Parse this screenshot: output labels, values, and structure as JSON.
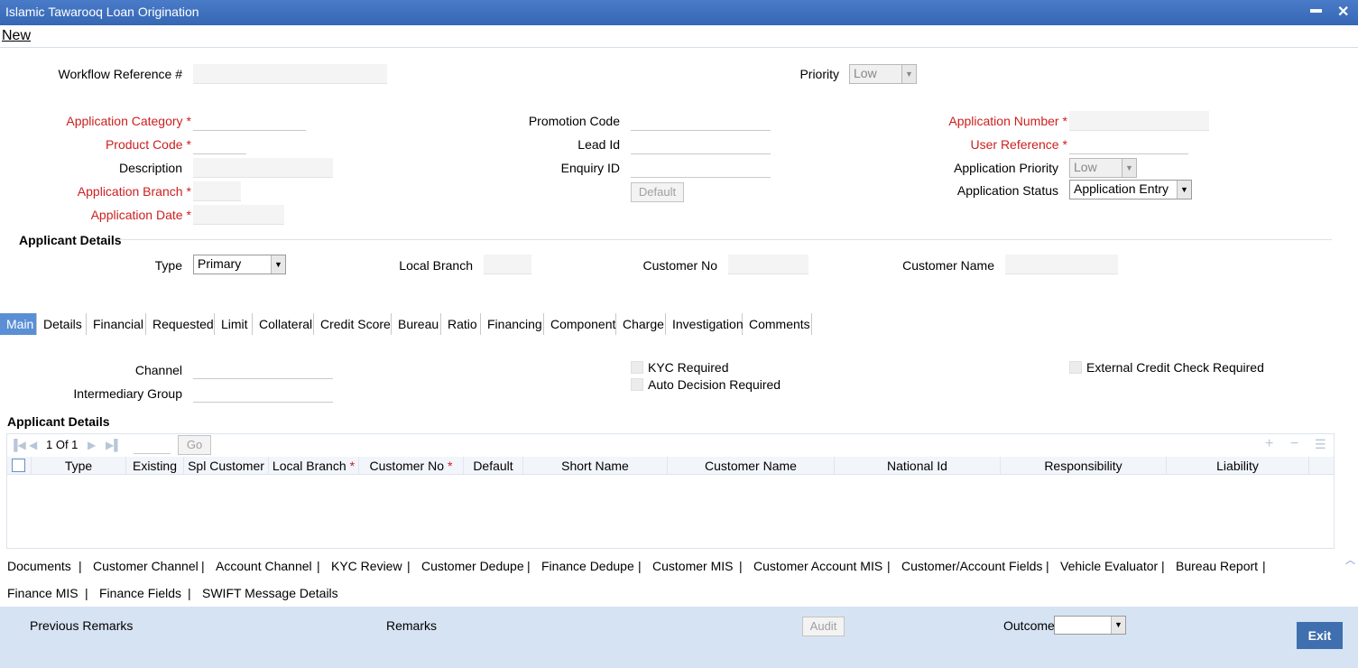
{
  "window": {
    "title": "Islamic Tawarooq Loan Origination",
    "minimize": "▬",
    "close": "✕"
  },
  "menu": {
    "new": "New"
  },
  "header": {
    "workflow_reference_label": "Workflow Reference #",
    "priority_label": "Priority",
    "priority_value": "Low"
  },
  "form": {
    "application_category_label": "Application Category",
    "product_code_label": "Product Code",
    "description_label": "Description",
    "application_branch_label": "Application Branch",
    "application_date_label": "Application Date",
    "promotion_code_label": "Promotion Code",
    "lead_id_label": "Lead Id",
    "enquiry_id_label": "Enquiry ID",
    "default_button": "Default",
    "application_number_label": "Application Number",
    "user_reference_label": "User Reference",
    "application_priority_label": "Application Priority",
    "application_priority_value": "Low",
    "application_status_label": "Application Status",
    "application_status_value": "Application Entry",
    "required_marker": "*"
  },
  "applicant": {
    "heading": "Applicant Details",
    "type_label": "Type",
    "type_value": "Primary",
    "local_branch_label": "Local Branch",
    "customer_no_label": "Customer No",
    "customer_name_label": "Customer Name"
  },
  "tabs": [
    "Main",
    "Details",
    "Financial",
    "Requested",
    "Limit",
    "Collateral",
    "Credit Score",
    "Bureau",
    "Ratio",
    "Financing",
    "Component",
    "Charge",
    "Investigation",
    "Comments"
  ],
  "main": {
    "channel_label": "Channel",
    "intermediary_group_label": "Intermediary Group",
    "kyc_required": "KYC Required",
    "auto_decision_required": "Auto Decision Required",
    "external_credit_check_required": "External Credit Check Required",
    "applicant_details_heading": "Applicant Details"
  },
  "grid": {
    "page_info": "1 Of 1",
    "go_button": "Go",
    "columns": [
      "Type",
      "Existing",
      "Spl Customer",
      "Local Branch",
      "Customer No",
      "Default",
      "Short Name",
      "Customer Name",
      "National Id",
      "Responsibility",
      "Liability"
    ],
    "required_marker": "*"
  },
  "links": {
    "row1": [
      "Documents",
      "Customer Channel",
      "Account Channel",
      "KYC Review",
      "Customer Dedupe",
      "Finance Dedupe",
      "Customer MIS",
      "Customer Account MIS",
      "Customer/Account Fields",
      "Vehicle Evaluator",
      "Bureau Report"
    ],
    "row2": [
      "Finance MIS",
      "Finance Fields",
      "SWIFT Message Details"
    ],
    "separator": "|"
  },
  "footer": {
    "previous_remarks": "Previous Remarks",
    "remarks": "Remarks",
    "audit_button": "Audit",
    "outcome_label": "Outcome",
    "exit_button": "Exit"
  },
  "colors": {
    "titlebar": "#3567b5",
    "required_label": "#cc1f1f",
    "active_tab": "#5a8fd6",
    "footer_bg": "#d6e3f3",
    "exit_button": "#3f6fae"
  }
}
